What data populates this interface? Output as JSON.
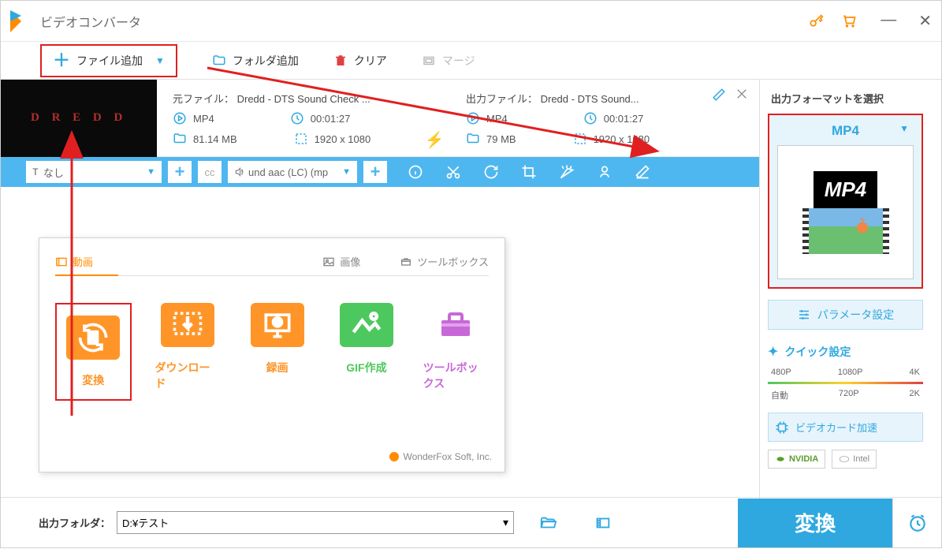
{
  "app": {
    "title": "ビデオコンバータ"
  },
  "toolbar": {
    "addFile": "ファイル追加",
    "addFolder": "フォルダ追加",
    "clear": "クリア",
    "merge": "マージ"
  },
  "file": {
    "srcLabel": "元ファイル： Dredd - DTS Sound Check ...",
    "srcFormat": "MP4",
    "srcDuration": "00:01:27",
    "srcSize": "81.14 MB",
    "srcRes": "1920 x 1080",
    "outLabel": "出力ファイル： Dredd - DTS Sound...",
    "outFormat": "MP4",
    "outDuration": "00:01:27",
    "outSize": "79 MB",
    "outRes": "1920 x 1080"
  },
  "toolbar2": {
    "sub": "なし",
    "audio": "und aac (LC) (mp"
  },
  "panel": {
    "tabs": {
      "video": "動画",
      "image": "画像",
      "toolbox": "ツールボックス"
    },
    "tiles": {
      "convert": "変換",
      "download": "ダウンロード",
      "record": "録画",
      "gif": "GIF作成",
      "tools": "ツールボックス"
    },
    "brand": "WonderFox Soft, Inc."
  },
  "right": {
    "formatLabel": "出力フォーマットを選択",
    "formatName": "MP4",
    "formatBadge": "MP4",
    "param": "パラメータ設定",
    "quick": "クイック設定",
    "res": {
      "r1": "480P",
      "r2": "1080P",
      "r3": "4K",
      "s1": "自動",
      "s2": "720P",
      "s3": "2K"
    },
    "vcard": "ビデオカード加速",
    "nvidia": "NVIDIA",
    "intel": "Intel"
  },
  "footer": {
    "label": "出力フォルダ：",
    "path": "D:¥テスト",
    "convert": "変換"
  }
}
